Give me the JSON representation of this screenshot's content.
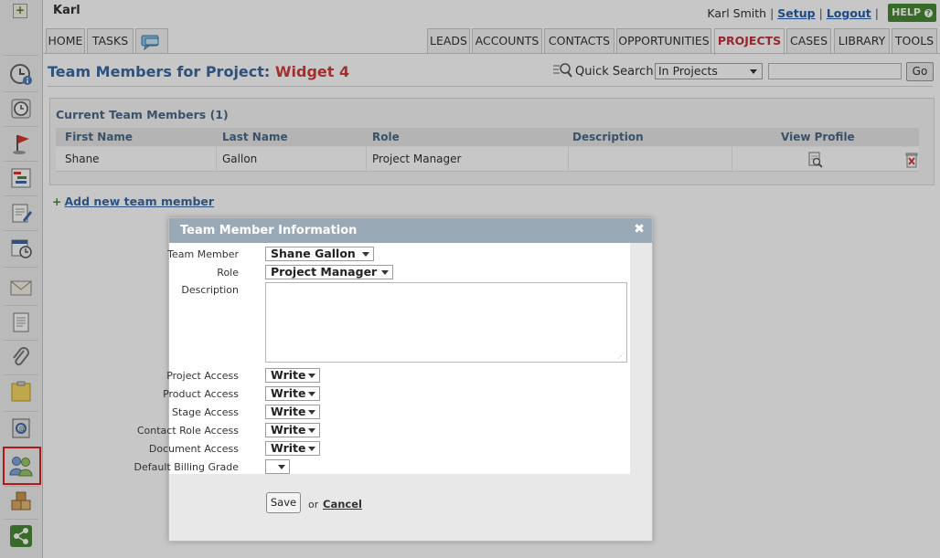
{
  "header": {
    "user_short": "Karl",
    "user_full": "Karl Smith",
    "setup_link": "Setup",
    "logout_link": "Logout",
    "help_label": "HELP",
    "help_icon": "question-icon",
    "separator": "|"
  },
  "tabs": {
    "left": [
      {
        "label": "HOME"
      },
      {
        "label": "TASKS"
      }
    ],
    "chat_icon": "chat-bubble-icon",
    "right": [
      {
        "label": "LEADS"
      },
      {
        "label": "ACCOUNTS"
      },
      {
        "label": "CONTACTS"
      },
      {
        "label": "OPPORTUNITIES"
      },
      {
        "label": "PROJECTS",
        "active": true
      },
      {
        "label": "CASES"
      },
      {
        "label": "LIBRARY"
      },
      {
        "label": "TOOLS"
      }
    ]
  },
  "page": {
    "title_prefix": "Team Members for Project:",
    "project_name": "Widget 4",
    "quick_search_label": "Quick Search",
    "quick_search_scope": "In Projects",
    "quick_search_value": "",
    "go_label": "Go"
  },
  "team": {
    "section_title": "Current Team Members (1)",
    "columns": [
      "First Name",
      "Last Name",
      "Role",
      "Description",
      "View Profile"
    ],
    "rows": [
      {
        "first": "Shane",
        "last": "Gallon",
        "role": "Project Manager",
        "description": ""
      }
    ],
    "add_link": "Add new team member"
  },
  "dialog": {
    "title": "Team Member Information",
    "close_glyph": "✖",
    "fields": {
      "team_member_label": "Team Member",
      "team_member_value": "Shane Gallon",
      "role_label": "Role",
      "role_value": "Project Manager",
      "description_label": "Description",
      "description_value": "",
      "project_access_label": "Project Access",
      "project_access_value": "Write",
      "product_access_label": "Product Access",
      "product_access_value": "Write",
      "stage_access_label": "Stage Access",
      "stage_access_value": "Write",
      "contact_role_access_label": "Contact Role Access",
      "contact_role_access_value": "Write",
      "document_access_label": "Document Access",
      "document_access_value": "Write",
      "billing_grade_label": "Default Billing Grade",
      "billing_grade_value": ""
    },
    "save_label": "Save",
    "or_label": "or",
    "cancel_label": "Cancel"
  },
  "sidebar": {
    "items": [
      {
        "icon": "clock-info-icon"
      },
      {
        "icon": "clock-list-icon"
      },
      {
        "icon": "flag-icon"
      },
      {
        "icon": "gantt-chart-icon"
      },
      {
        "icon": "document-pencil-icon"
      },
      {
        "icon": "calendar-clock-icon"
      },
      {
        "icon": "envelope-icon"
      },
      {
        "icon": "document-text-icon"
      },
      {
        "icon": "paperclip-icon"
      },
      {
        "icon": "sticky-note-icon"
      },
      {
        "icon": "address-book-icon"
      },
      {
        "icon": "team-members-icon",
        "selected": true
      },
      {
        "icon": "boxes-icon"
      },
      {
        "icon": "share-icon"
      }
    ]
  },
  "colors": {
    "accent_blue": "#3b6aa0",
    "project_red": "#d33a3a",
    "help_green": "#4a8a34",
    "dialog_header": "#9aa9b6",
    "selection_red": "#e02020"
  }
}
